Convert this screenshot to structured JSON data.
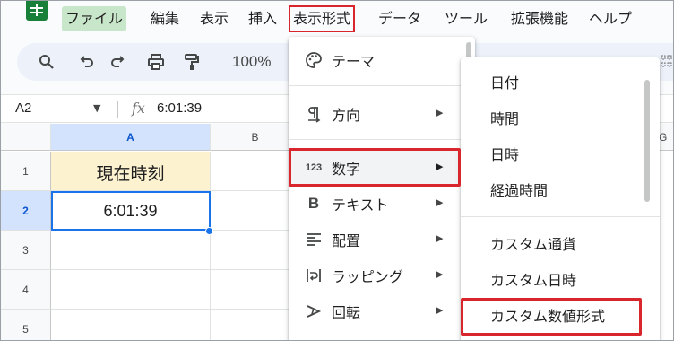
{
  "menubar": {
    "items": [
      "ファイル",
      "編集",
      "表示",
      "挿入",
      "表示形式",
      "データ",
      "ツール",
      "拡張機能",
      "ヘルプ"
    ]
  },
  "toolbar": {
    "icons": [
      "search-icon",
      "undo-icon",
      "redo-icon",
      "print-icon",
      "paint-format-icon"
    ],
    "zoom": "100%"
  },
  "formula_bar": {
    "cell_ref": "A2",
    "fx": "fx",
    "value": "6:01:39"
  },
  "grid": {
    "columns": [
      "A",
      "G"
    ],
    "partial_column": "B",
    "rows": [
      "1",
      "2",
      "3",
      "4",
      "5"
    ],
    "a1_text": "現在時刻",
    "a2_text": "6:01:39"
  },
  "format_menu": {
    "items": [
      {
        "icon": "palette-icon",
        "label": "テーマ",
        "submenu": false
      },
      {
        "icon": "text-direction-icon",
        "label": "方向",
        "submenu": true
      },
      {
        "icon": "number-123-icon",
        "label": "数字",
        "submenu": true
      },
      {
        "icon": "bold-icon",
        "label": "テキスト",
        "submenu": true
      },
      {
        "icon": "align-icon",
        "label": "配置",
        "submenu": true
      },
      {
        "icon": "wrap-icon",
        "label": "ラッピング",
        "submenu": true
      },
      {
        "icon": "rotate-icon",
        "label": "回転",
        "submenu": true
      }
    ],
    "icon_123": "123",
    "icon_b": "B"
  },
  "number_submenu": {
    "items": [
      "日付",
      "時間",
      "日時",
      "経過時間",
      "カスタム通貨",
      "カスタム日時",
      "カスタム数値形式"
    ]
  },
  "colors": {
    "highlight_red": "#d9262d",
    "selection_blue": "#1a73e8",
    "a1_fill": "#fdf2d0",
    "sheets_green": "#188038"
  }
}
